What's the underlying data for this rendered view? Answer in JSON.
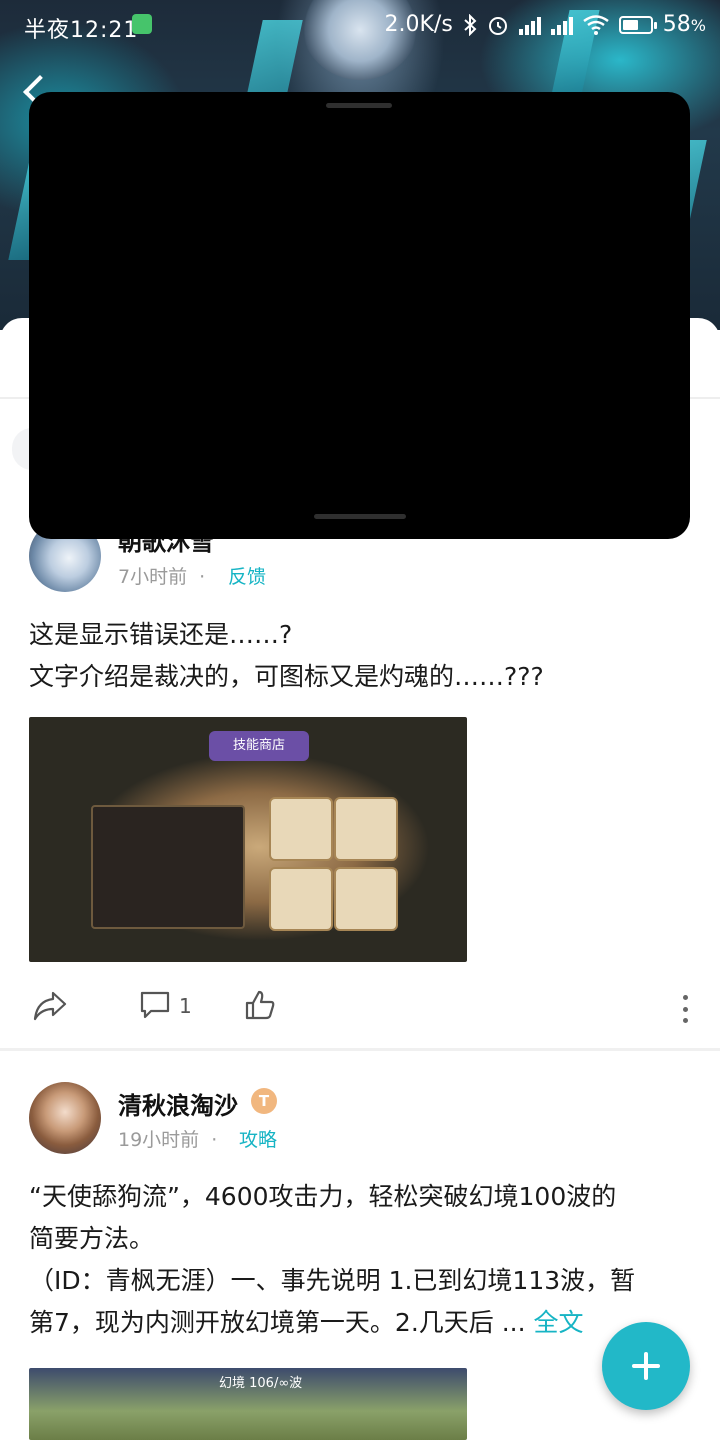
{
  "status_bar": {
    "time": "半夜12:21",
    "net_speed": "2.0K/s",
    "battery_percent": "58",
    "battery_suffix": "%"
  },
  "posts": [
    {
      "username": "朝歌沐雪",
      "time_ago": "7小时前",
      "separator": "·",
      "category": "反馈",
      "text_lines": [
        "这是显示错误还是……?",
        "文字介绍是裁决的，可图标又是灼魂的……???"
      ],
      "image_label": "技能商店",
      "comments": "1"
    },
    {
      "username": "清秋浪淘沙",
      "badge": "T",
      "time_ago": "19小时前",
      "separator": "·",
      "category": "攻略",
      "text_lines": [
        "“天使舔狗流”，4600攻击力，轻松突破幻境100波的",
        "简要方法。",
        "（ID：青枫无涯）一、事先说明 1.已到幻境113波，暂",
        "第7，现为内测开放幻境第一天。2.几天后 ..."
      ],
      "more_label": "全文",
      "image_label": "幻境 106/∞波"
    }
  ],
  "colors": {
    "accent": "#22b8c8",
    "link": "#16b4c4"
  },
  "icons": {
    "share": "share-icon",
    "comment": "comment-icon",
    "like": "thumbs-up-icon",
    "more": "more-vertical-icon",
    "fab": "plus-icon"
  }
}
